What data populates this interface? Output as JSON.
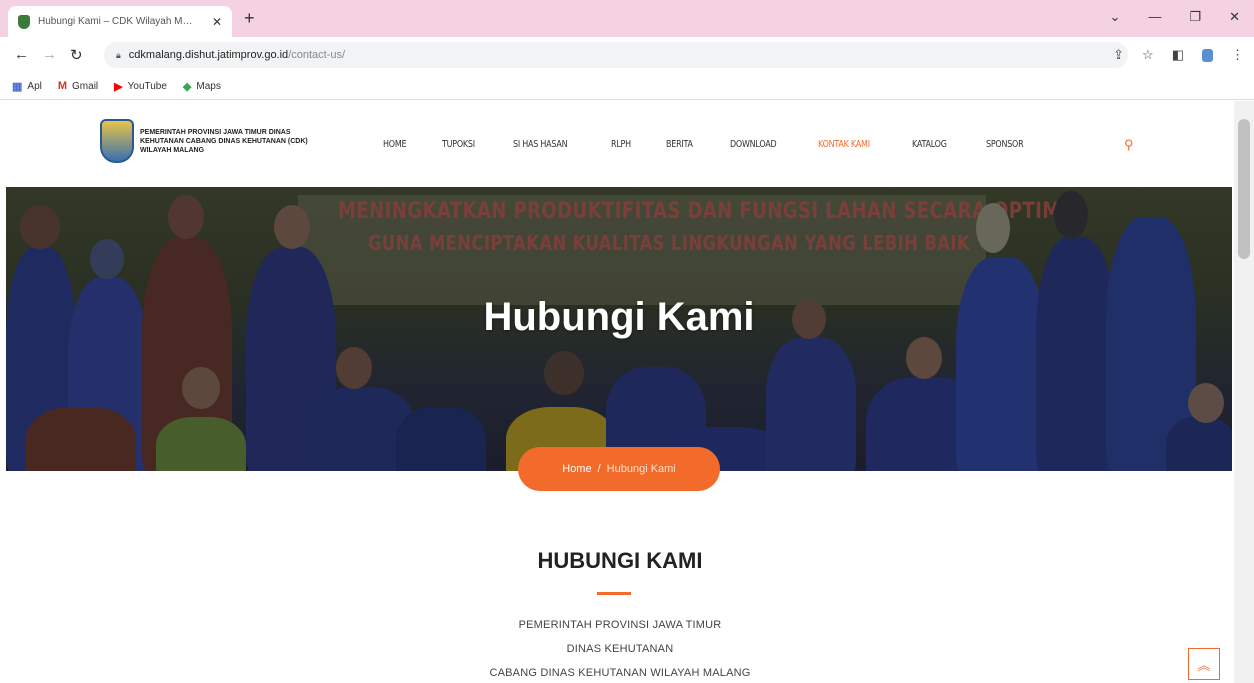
{
  "browser": {
    "tab_title": "Hubungi Kami – CDK Wilayah M…",
    "tab_close": "✕",
    "new_tab": "+",
    "url_host": "cdkmalang.dishut.jatimprov.go.id",
    "url_path": "/contact-us/",
    "bookmarks": [
      {
        "icon": "▦",
        "label": "Apl"
      },
      {
        "icon": "M",
        "label": "Gmail"
      },
      {
        "icon": "▶",
        "label": "YouTube"
      },
      {
        "icon": "◆",
        "label": "Maps"
      }
    ],
    "colors": {
      "tabbar": "#f4d2e2",
      "gmail": "#d93025",
      "youtube": "#ff0000",
      "maps": "#34a853"
    }
  },
  "site": {
    "logo_text": "PEMERINTAH PROVINSI JAWA TIMUR DINAS KEHUTANAN CABANG DINAS KEHUTANAN (CDK) WILAYAH MALANG",
    "nav": [
      "HOME",
      "TUPOKSI",
      "SI HAS HASAN",
      "RLPH",
      "BERITA",
      "DOWNLOAD",
      "KONTAK KAMI",
      "KATALOG",
      "SPONSOR"
    ],
    "active_nav": "KONTAK KAMI",
    "accent": "#f26b2a"
  },
  "hero": {
    "banner_line1": "MENINGKATKAN PRODUKTIFITAS DAN FUNGSI LAHAN SECARA OPTIMAL",
    "banner_line2": "GUNA MENCIPTAKAN KUALITAS LINGKUNGAN YANG LEBIH BAIK",
    "title": "Hubungi Kami",
    "breadcrumb_home": "Home",
    "breadcrumb_sep": "/",
    "breadcrumb_current": "Hubungi Kami"
  },
  "content": {
    "section_title": "HUBUNGI KAMI",
    "lines": [
      "PEMERINTAH PROVINSI JAWA TIMUR",
      "DINAS KEHUTANAN",
      "CABANG DINAS KEHUTANAN WILAYAH MALANG"
    ]
  }
}
